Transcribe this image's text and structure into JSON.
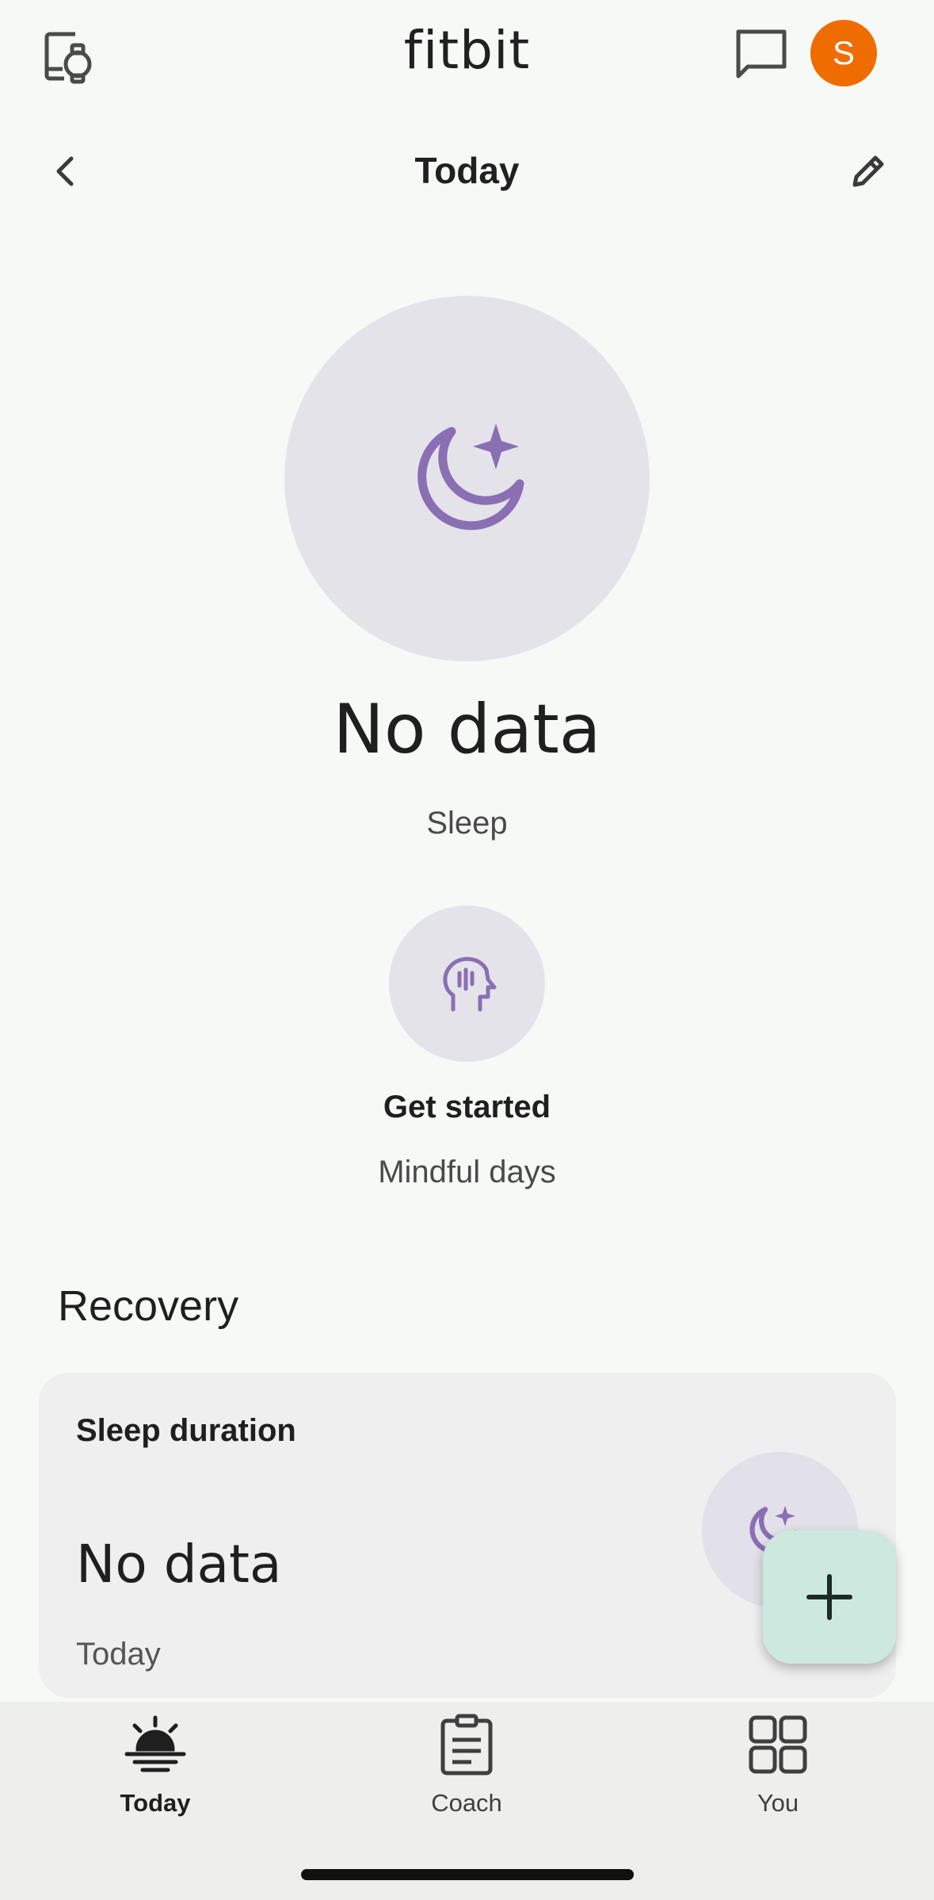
{
  "header": {
    "app_logo": "fitbit",
    "avatar_initial": "S",
    "avatar_color": "#ef6c00",
    "icons": [
      "devices-icon",
      "message-icon",
      "back-icon",
      "edit-icon"
    ]
  },
  "page": {
    "title": "Today"
  },
  "hero": {
    "icon": "moon-star-icon",
    "value": "No data",
    "label": "Sleep",
    "accent_color": "#8a6fb3"
  },
  "mindful": {
    "icon": "mind-icon",
    "status": "Get started",
    "label": "Mindful days"
  },
  "recovery": {
    "section_title": "Recovery",
    "card": {
      "title": "Sleep duration",
      "value": "No data",
      "subtitle": "Today",
      "icon": "moon-star-icon"
    }
  },
  "fab": {
    "icon": "plus-icon",
    "color": "#cde8df"
  },
  "bottom_nav": {
    "items": [
      {
        "label": "Today",
        "icon": "sunrise-icon",
        "active": true
      },
      {
        "label": "Coach",
        "icon": "clipboard-icon",
        "active": false
      },
      {
        "label": "You",
        "icon": "grid-icon",
        "active": false
      }
    ]
  }
}
